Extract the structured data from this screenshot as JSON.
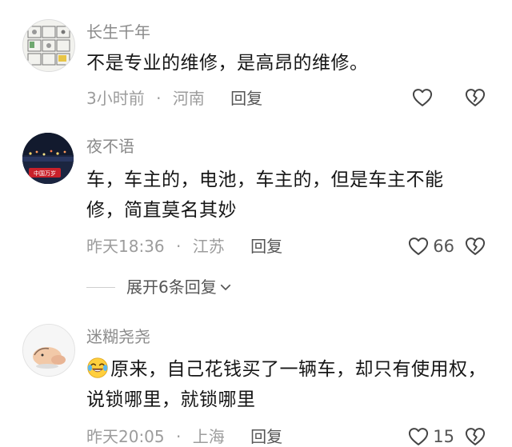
{
  "comments": [
    {
      "username": "长生千年",
      "content": "不是专业的维修，是高昂的维修。",
      "time": "3小时前",
      "location": "河南",
      "reply_label": "回复",
      "likes": ""
    },
    {
      "username": "夜不语",
      "content": "车，车主的，电池，车主的，但是车主不能修，简直莫名其妙",
      "time": "昨天18:36",
      "location": "江苏",
      "reply_label": "回复",
      "likes": "66"
    },
    {
      "username": "迷糊尧尧",
      "content": "原来，自己花钱买了一辆车，却只有使用权，说锁哪里，就锁哪里",
      "time": "昨天20:05",
      "location": "上海",
      "reply_label": "回复",
      "likes": "15"
    }
  ],
  "expand_replies": "展开6条回复",
  "separator": "·",
  "icons": {
    "like": "heart-outline-icon",
    "dislike": "broken-heart-icon",
    "expand": "chevron-down-icon",
    "emoji": "laughing-tears-emoji"
  },
  "colors": {
    "text_primary": "#161616",
    "text_secondary": "#9c9c9c",
    "username": "#8a8a8a",
    "action": "#555555"
  }
}
